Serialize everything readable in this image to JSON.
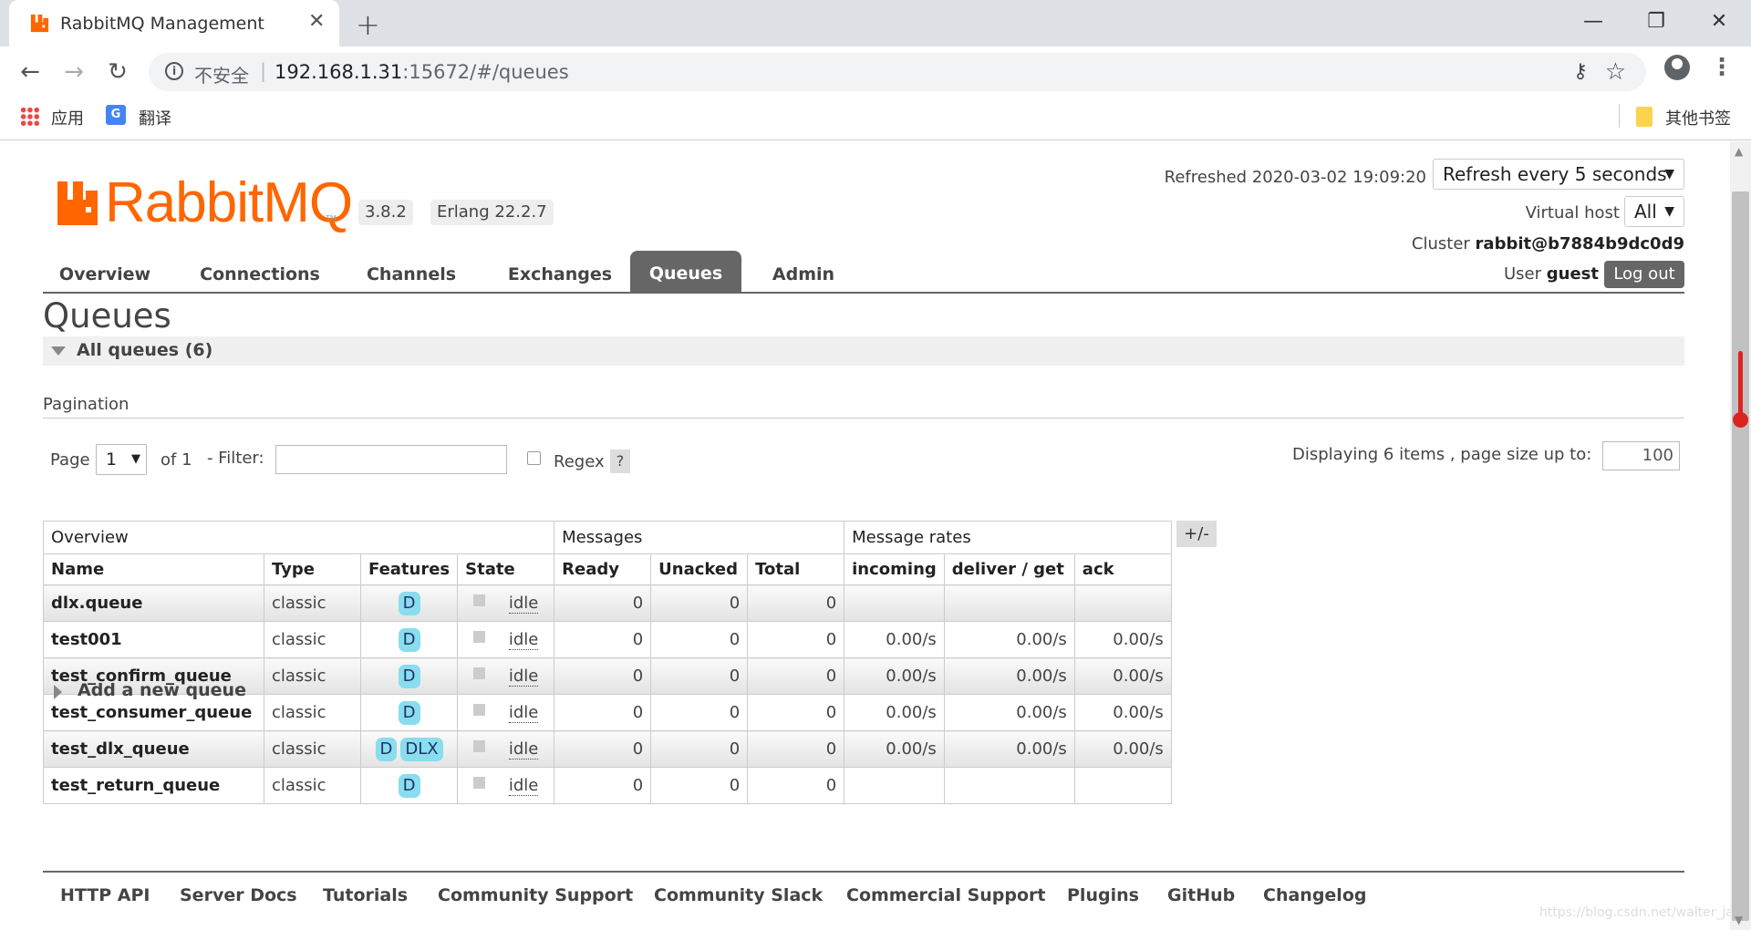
{
  "browser": {
    "tab_title": "RabbitMQ Management",
    "tab_close": "✕",
    "new_tab": "+",
    "window_min": "—",
    "window_restore": "❐",
    "window_close": "✕",
    "back": "←",
    "forward": "→",
    "reload": "↻",
    "insecure_label": "不安全",
    "url_host": "192.168.1.31",
    "url_rest": ":15672/#/queues",
    "key_icon": "⚷",
    "star_icon": "☆",
    "menu_icon": "⋮",
    "bookmarks": {
      "apps_label": "应用",
      "translate_label": "翻译",
      "translate_glyph": "G",
      "other_label": "其他书签"
    }
  },
  "header": {
    "logo_text": "RabbitMQ",
    "logo_tm": "TM",
    "version": "3.8.2",
    "erlang": "Erlang 22.2.7",
    "refreshed_label": "Refreshed 2020-03-02 19:09:20",
    "refresh_select": "Refresh every 5 seconds",
    "vhost_label": "Virtual host",
    "vhost_select": "All",
    "cluster_label": "Cluster",
    "cluster_name": "rabbit@b7884b9dc0d9",
    "user_label": "User",
    "user_name": "guest",
    "logout": "Log out",
    "caret": "▼"
  },
  "nav": {
    "tabs": [
      "Overview",
      "Connections",
      "Channels",
      "Exchanges",
      "Queues",
      "Admin"
    ],
    "active": "Queues"
  },
  "page_title": "Queues",
  "section_title": "All queues (6)",
  "pagination": {
    "label": "Pagination",
    "page_label": "Page",
    "page_value": "1",
    "of_label": "of 1",
    "filter_label": "- Filter:",
    "filter_value": "",
    "regex_label": "Regex",
    "help": "?",
    "displaying": "Displaying 6 items , page size up to:",
    "page_size": "100"
  },
  "table": {
    "groups": [
      "Overview",
      "Messages",
      "Message rates"
    ],
    "columns": [
      "Name",
      "Type",
      "Features",
      "State",
      "Ready",
      "Unacked",
      "Total",
      "incoming",
      "deliver / get",
      "ack"
    ],
    "plus_minus": "+/-",
    "rows": [
      {
        "name": "dlx.queue",
        "type": "classic",
        "features": [
          "D"
        ],
        "state": "idle",
        "ready": "0",
        "unacked": "0",
        "total": "0",
        "incoming": "",
        "deliver": "",
        "ack": ""
      },
      {
        "name": "test001",
        "type": "classic",
        "features": [
          "D"
        ],
        "state": "idle",
        "ready": "0",
        "unacked": "0",
        "total": "0",
        "incoming": "0.00/s",
        "deliver": "0.00/s",
        "ack": "0.00/s"
      },
      {
        "name": "test_confirm_queue",
        "type": "classic",
        "features": [
          "D"
        ],
        "state": "idle",
        "ready": "0",
        "unacked": "0",
        "total": "0",
        "incoming": "0.00/s",
        "deliver": "0.00/s",
        "ack": "0.00/s"
      },
      {
        "name": "test_consumer_queue",
        "type": "classic",
        "features": [
          "D"
        ],
        "state": "idle",
        "ready": "0",
        "unacked": "0",
        "total": "0",
        "incoming": "0.00/s",
        "deliver": "0.00/s",
        "ack": "0.00/s"
      },
      {
        "name": "test_dlx_queue",
        "type": "classic",
        "features": [
          "D",
          "DLX"
        ],
        "state": "idle",
        "ready": "0",
        "unacked": "0",
        "total": "0",
        "incoming": "0.00/s",
        "deliver": "0.00/s",
        "ack": "0.00/s"
      },
      {
        "name": "test_return_queue",
        "type": "classic",
        "features": [
          "D"
        ],
        "state": "idle",
        "ready": "0",
        "unacked": "0",
        "total": "0",
        "incoming": "",
        "deliver": "",
        "ack": ""
      }
    ]
  },
  "add_queue": "Add a new queue",
  "footer": {
    "links": [
      "HTTP API",
      "Server Docs",
      "Tutorials",
      "Community Support",
      "Community Slack",
      "Commercial Support",
      "Plugins",
      "GitHub",
      "Changelog"
    ]
  },
  "watermark": "https://blog.csdn.net/walter_jay",
  "colors": {
    "brand": "#ff6600",
    "nav_active": "#666666",
    "feature_badge": "#88ddee"
  }
}
